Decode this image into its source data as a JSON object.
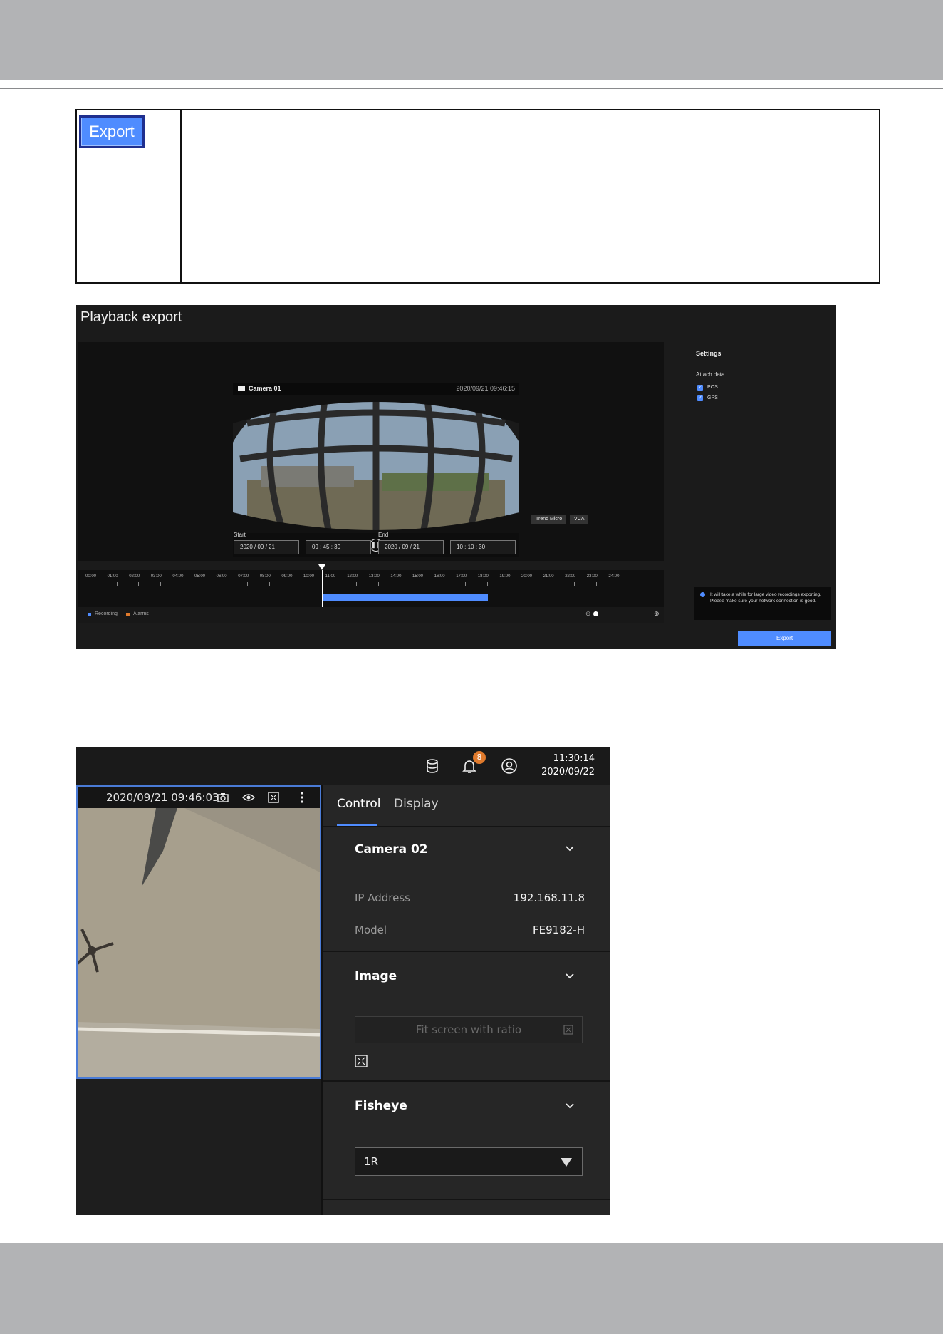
{
  "info_table": {
    "button_label": "Export"
  },
  "playback_export": {
    "title": "Playback export",
    "camera_name": "Camera 01",
    "camera_timestamp": "2020/09/21 09:46:15",
    "tags": [
      "Trend Micro",
      "VCA"
    ],
    "start_label": "Start",
    "end_label": "End",
    "start_date": "2020 / 09 / 21",
    "start_time": "09 : 45 : 30",
    "range_separator": "–",
    "end_date": "2020 / 09 / 21",
    "end_time": "10 : 10 : 30",
    "timeline_hours": [
      "00:00",
      "01:00",
      "02:00",
      "03:00",
      "04:00",
      "05:00",
      "06:00",
      "07:00",
      "08:00",
      "09:00",
      "10:00",
      "11:00",
      "12:00",
      "13:00",
      "14:00",
      "15:00",
      "16:00",
      "17:00",
      "18:00",
      "19:00",
      "20:00",
      "21:00",
      "22:00",
      "23:00",
      "24:00"
    ],
    "legend": {
      "recording": "Recording",
      "alarms": "Alarms"
    },
    "colors": {
      "accent": "#4f8cff",
      "alarms": "#e07a2c"
    },
    "settings": {
      "title": "Settings",
      "attach_label": "Attach data",
      "pos_label": "POS",
      "gps_label": "GPS",
      "pos_checked": true,
      "gps_checked": true
    },
    "notice": "It will take a while for large video recordings exporting. Please make sure your network connection is good.",
    "export_button": "Export"
  },
  "camera_control": {
    "notification_count": "8",
    "clock_time": "11:30:14",
    "clock_date": "2020/09/22",
    "video_timestamp": "2020/09/21 09:46:03",
    "tabs": {
      "control": "Control",
      "display": "Display"
    },
    "camera_section": {
      "title": "Camera 02",
      "ip_label": "IP Address",
      "ip_value": "192.168.11.8",
      "model_label": "Model",
      "model_value": "FE9182-H"
    },
    "image_section": {
      "title": "Image",
      "fit_placeholder": "Fit screen with ratio"
    },
    "fisheye_section": {
      "title": "Fisheye",
      "mode_value": "1R"
    }
  }
}
